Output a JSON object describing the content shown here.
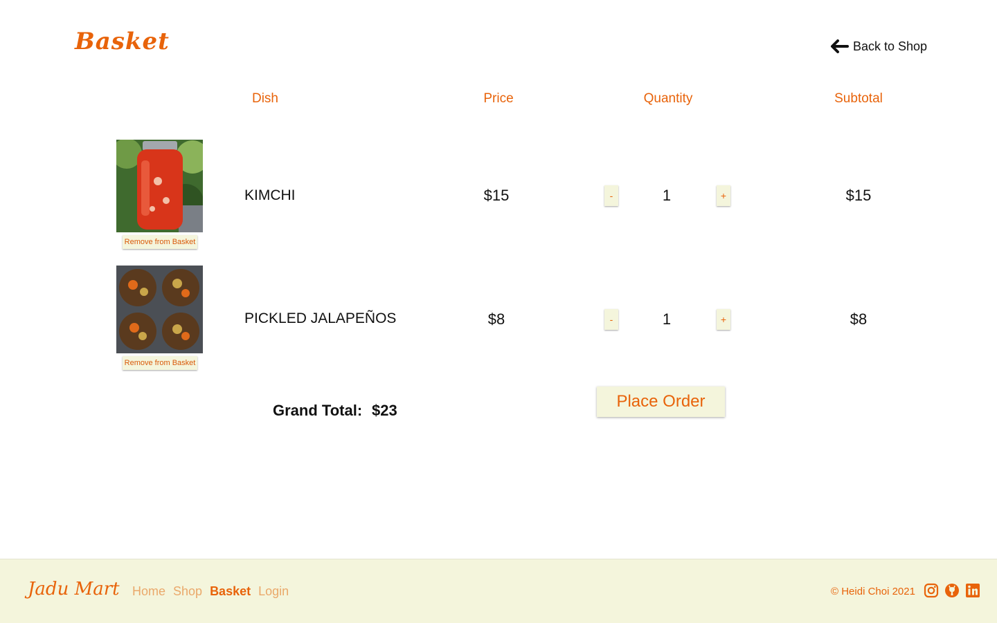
{
  "header": {
    "title": "Basket",
    "back_label": "Back to Shop"
  },
  "table": {
    "columns": [
      "Dish",
      "Price",
      "Quantity",
      "Subtotal"
    ],
    "rows": [
      {
        "name": "KIMCHI",
        "price": "$15",
        "quantity": "1",
        "subtotal": "$15",
        "remove_label": "Remove from Basket",
        "decrement_label": "-",
        "increment_label": "+"
      },
      {
        "name": "PICKLED JALAPEÑOS",
        "price": "$8",
        "quantity": "1",
        "subtotal": "$8",
        "remove_label": "Remove from Basket",
        "decrement_label": "-",
        "increment_label": "+"
      }
    ]
  },
  "summary": {
    "grand_total_label": "Grand Total:",
    "grand_total_value": "$23",
    "place_order_label": "Place Order"
  },
  "footer": {
    "logo": "Jadu Mart",
    "nav": [
      "Home",
      "Shop",
      "Basket",
      "Login"
    ],
    "active_nav": "Basket",
    "copyright": "© Heidi Choi 2021",
    "social_icons": [
      "instagram-icon",
      "github-icon",
      "linkedin-icon"
    ]
  },
  "colors": {
    "accent": "#e8630a",
    "button_bg": "#f4f5dc",
    "footer_bg": "#f4f5dc"
  }
}
